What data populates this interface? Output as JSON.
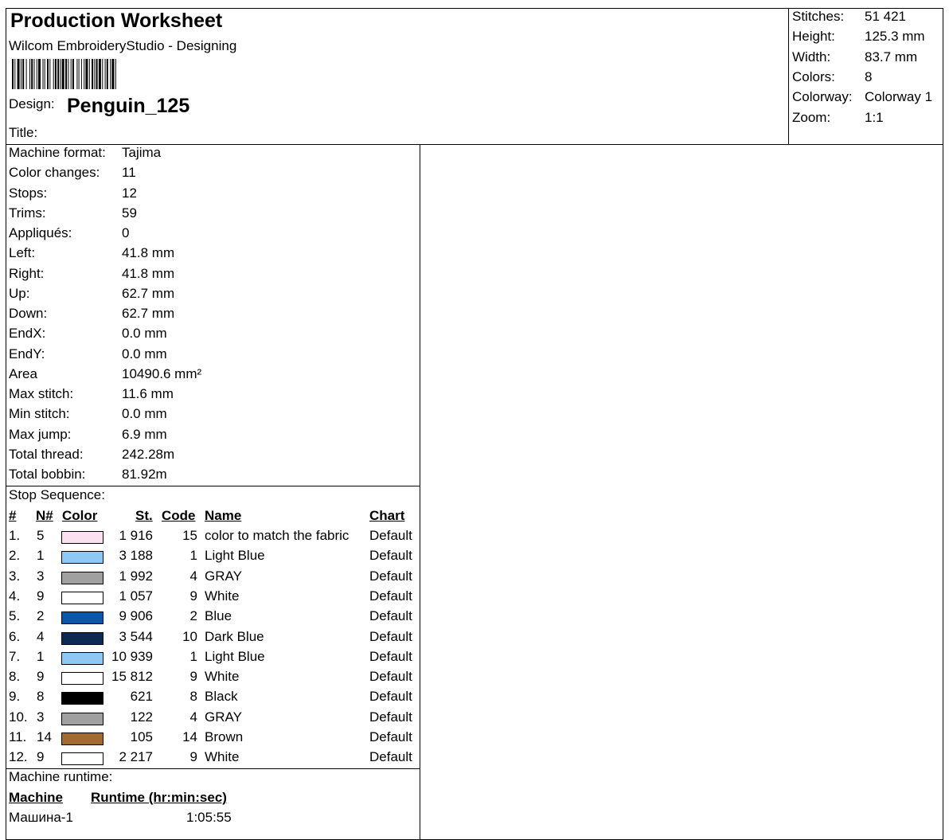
{
  "header": {
    "title": "Production Worksheet",
    "subtitle": "Wilcom EmbroideryStudio - Designing",
    "design_label": "Design:",
    "design_name": "Penguin_125",
    "title_label": "Title:",
    "title_value": ""
  },
  "summary": [
    {
      "label": "Stitches:",
      "value": "51 421"
    },
    {
      "label": "Height:",
      "value": "125.3 mm"
    },
    {
      "label": "Width:",
      "value": "83.7 mm"
    },
    {
      "label": "Colors:",
      "value": "8"
    },
    {
      "label": "Colorway:",
      "value": "Colorway 1"
    },
    {
      "label": "Zoom:",
      "value": "1:1"
    }
  ],
  "details": [
    {
      "label": "Machine format:",
      "value": "Tajima"
    },
    {
      "label": "Color changes:",
      "value": "11"
    },
    {
      "label": "Stops:",
      "value": "12"
    },
    {
      "label": "Trims:",
      "value": "59"
    },
    {
      "label": "Appliqués:",
      "value": "0"
    },
    {
      "label": "Left:",
      "value": "41.8 mm"
    },
    {
      "label": "Right:",
      "value": "41.8 mm"
    },
    {
      "label": "Up:",
      "value": "62.7 mm"
    },
    {
      "label": "Down:",
      "value": "62.7 mm"
    },
    {
      "label": "EndX:",
      "value": "0.0 mm"
    },
    {
      "label": "EndY:",
      "value": "0.0 mm"
    },
    {
      "label": "Area",
      "value": "10490.6 mm²"
    },
    {
      "label": "Max stitch:",
      "value": "11.6 mm"
    },
    {
      "label": "Min stitch:",
      "value": "0.0 mm"
    },
    {
      "label": "Max jump:",
      "value": "6.9 mm"
    },
    {
      "label": "Total thread:",
      "value": "242.28m"
    },
    {
      "label": "Total bobbin:",
      "value": "81.92m"
    }
  ],
  "stop_sequence": {
    "heading": "Stop Sequence:",
    "columns": {
      "num": "#",
      "n": "N#",
      "color": "Color",
      "st": "St.",
      "code": "Code",
      "name": "Name",
      "chart": "Chart"
    },
    "rows": [
      {
        "num": "1.",
        "n": "5",
        "color": "#fbe0f0",
        "st": "1 916",
        "code": "15",
        "name": "color to match the fabric",
        "chart": "Default"
      },
      {
        "num": "2.",
        "n": "1",
        "color": "#8ec8f4",
        "st": "3 188",
        "code": "1",
        "name": "Light Blue",
        "chart": "Default"
      },
      {
        "num": "3.",
        "n": "3",
        "color": "#a0a0a0",
        "st": "1 992",
        "code": "4",
        "name": "GRAY",
        "chart": "Default"
      },
      {
        "num": "4.",
        "n": "9",
        "color": "#ffffff",
        "st": "1 057",
        "code": "9",
        "name": "White",
        "chart": "Default"
      },
      {
        "num": "5.",
        "n": "2",
        "color": "#0a56a8",
        "st": "9 906",
        "code": "2",
        "name": "Blue",
        "chart": "Default"
      },
      {
        "num": "6.",
        "n": "4",
        "color": "#0d2b52",
        "st": "3 544",
        "code": "10",
        "name": "Dark Blue",
        "chart": "Default"
      },
      {
        "num": "7.",
        "n": "1",
        "color": "#8ec8f4",
        "st": "10 939",
        "code": "1",
        "name": "Light Blue",
        "chart": "Default"
      },
      {
        "num": "8.",
        "n": "9",
        "color": "#ffffff",
        "st": "15 812",
        "code": "9",
        "name": "White",
        "chart": "Default"
      },
      {
        "num": "9.",
        "n": "8",
        "color": "#000000",
        "st": "621",
        "code": "8",
        "name": "Black",
        "chart": "Default"
      },
      {
        "num": "10.",
        "n": "3",
        "color": "#a0a0a0",
        "st": "122",
        "code": "4",
        "name": "GRAY",
        "chart": "Default"
      },
      {
        "num": "11.",
        "n": "14",
        "color": "#a06a30",
        "st": "105",
        "code": "14",
        "name": "Brown",
        "chart": "Default"
      },
      {
        "num": "12.",
        "n": "9",
        "color": "#ffffff",
        "st": "2 217",
        "code": "9",
        "name": "White",
        "chart": "Default"
      }
    ]
  },
  "runtime": {
    "heading": "Machine runtime:",
    "col_machine": "Machine",
    "col_runtime": "Runtime (hr:min:sec)",
    "rows": [
      {
        "machine": "Машина-1",
        "runtime": "1:05:55"
      }
    ]
  }
}
